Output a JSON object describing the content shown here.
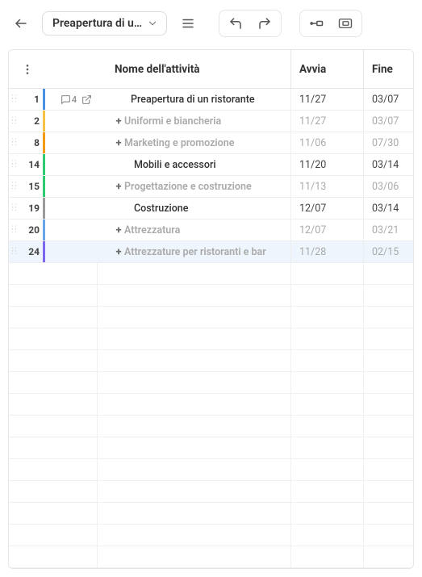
{
  "toolbar": {
    "title": "Preapertura di u…"
  },
  "columns": {
    "name": "Nome dell'attività",
    "start": "Avvia",
    "end": "Fine"
  },
  "rows": [
    {
      "num": "1",
      "color": "#4a90e2",
      "expander": "",
      "name": "Preapertura di un ristorante",
      "start": "11/27",
      "end": "03/07",
      "muted": false,
      "comments": "4",
      "link": true,
      "selected": false,
      "indent": 20
    },
    {
      "num": "2",
      "color": "#f6c244",
      "expander": "+",
      "name": "Uniformi e biancheria",
      "start": "11/27",
      "end": "03/07",
      "muted": true,
      "comments": "",
      "link": false,
      "selected": false,
      "indent": 12
    },
    {
      "num": "8",
      "color": "#f39c12",
      "expander": "+",
      "name": "Marketing e promozione",
      "start": "11/06",
      "end": "07/30",
      "muted": true,
      "comments": "",
      "link": false,
      "selected": false,
      "indent": 12
    },
    {
      "num": "14",
      "color": "#2ecc71",
      "expander": "",
      "name": "Mobili e accessori",
      "start": "11/20",
      "end": "03/14",
      "muted": false,
      "comments": "",
      "link": false,
      "selected": false,
      "indent": 24
    },
    {
      "num": "15",
      "color": "#2ecc71",
      "expander": "+",
      "name": "Progettazione e costruzione",
      "start": "11/13",
      "end": "03/06",
      "muted": true,
      "comments": "",
      "link": false,
      "selected": false,
      "indent": 12
    },
    {
      "num": "19",
      "color": "#9b9b9b",
      "expander": "",
      "name": "Costruzione",
      "start": "12/07",
      "end": "03/14",
      "muted": false,
      "comments": "",
      "link": false,
      "selected": false,
      "indent": 24
    },
    {
      "num": "20",
      "color": "#6aa4e8",
      "expander": "+",
      "name": "Attrezzatura",
      "start": "12/07",
      "end": "03/21",
      "muted": true,
      "comments": "",
      "link": false,
      "selected": false,
      "indent": 12
    },
    {
      "num": "24",
      "color": "#7b68ee",
      "expander": "+",
      "name": "Attrezzature per ristoranti e bar",
      "start": "11/28",
      "end": "02/15",
      "muted": true,
      "comments": "",
      "link": false,
      "selected": true,
      "indent": 12
    }
  ],
  "emptyRows": 14
}
